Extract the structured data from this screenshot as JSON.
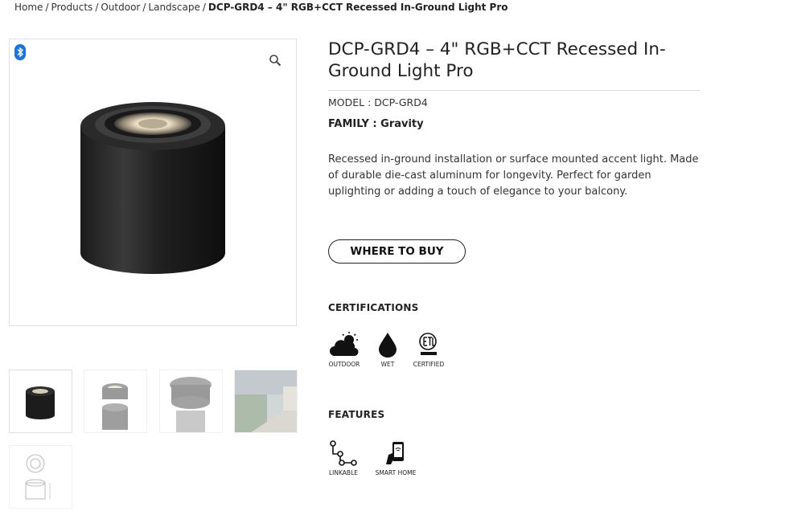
{
  "breadcrumb": {
    "items": [
      "Home",
      "Products",
      "Outdoor",
      "Landscape"
    ],
    "separator": "/",
    "current": "DCP-GRD4 – 4\" RGB+CCT Recessed In-Ground Light Pro"
  },
  "gallery": {
    "badge_icon": "bluetooth-icon",
    "zoom_icon": "magnifier-icon",
    "thumbnails": [
      "product-front",
      "cutaway-top",
      "mounting-detail",
      "garden-installation",
      "dimension-drawing"
    ]
  },
  "product": {
    "title": "DCP-GRD4 – 4\" RGB+CCT Recessed In-Ground Light Pro",
    "model_label": "MODEL : DCP-GRD4",
    "family_label": "FAMILY : Gravity",
    "description": "Recessed in-ground installation or surface mounted accent light. Made of durable die-cast aluminum for longevity. Perfect for garden uplighting or adding a touch of elegance to your balcony.",
    "buy_label": "WHERE TO BUY"
  },
  "certifications": {
    "heading": "CERTIFICATIONS",
    "items": [
      {
        "label": "OUTDOOR",
        "icon": "cloud-sun-icon"
      },
      {
        "label": "WET",
        "icon": "water-drop-icon"
      },
      {
        "label": "CERTIFIED",
        "icon": "etl-intertek-icon"
      }
    ]
  },
  "features": {
    "heading": "FEATURES",
    "items": [
      {
        "label": "LINKABLE",
        "icon": "linkable-icon"
      },
      {
        "label": "SMART HOME",
        "icon": "smart-phone-icon"
      }
    ]
  },
  "colors": {
    "text": "#222222",
    "border": "#e0e0e0",
    "bluetooth": "#1a73e8"
  }
}
